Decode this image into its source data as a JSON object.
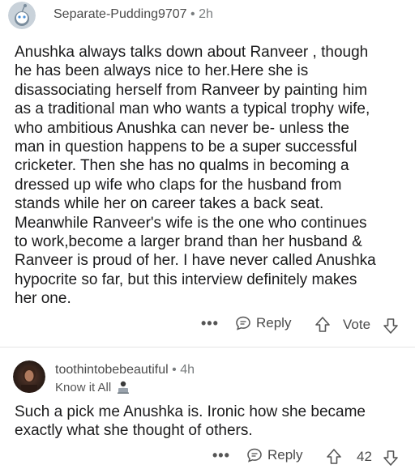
{
  "comment1": {
    "username": "Separate-Pudding9707",
    "separator": "•",
    "time": "2h",
    "body": "Anushka always talks down about Ranveer , though\nhe has been always nice to her.Here she is\ndisassociating herself from Ranveer by painting him\nas a traditional man who wants a typical trophy wife,\nwho ambitious Anushka can never be- unless the\nman in question happens to be a super successful\ncricketer. Then she has no qualms in becoming a\ndressed up wife who claps for the husband from\nstands while her on career takes a back seat.\nMeanwhile Ranveer's wife is the one who continues\nto work,become a larger brand than her husband &\nRanveer is proud of her. I have never called Anushka\nhypocrite so far, but this interview definitely makes\nher one.",
    "more_label": "•••",
    "reply_label": "Reply",
    "vote_label": "Vote"
  },
  "comment2": {
    "username": "toothintobebeautiful",
    "separator": "•",
    "time": "4h",
    "flair": "Know it All",
    "body": "Such a pick me Anushka is. Ironic how she became\nexactly what she thought of others.",
    "more_label": "•••",
    "reply_label": "Reply",
    "vote_count": "42"
  },
  "colors": {
    "text": "#1a1a1b",
    "meta": "#787c7e",
    "avatar_bg": "#c9d2da",
    "snoo": "#4a90d9"
  },
  "icons": {
    "reply": "speech-bubble-icon",
    "upvote": "arrow-up-icon",
    "downvote": "arrow-down-icon",
    "more": "ellipsis-icon",
    "flair": "person-at-laptop-icon"
  }
}
